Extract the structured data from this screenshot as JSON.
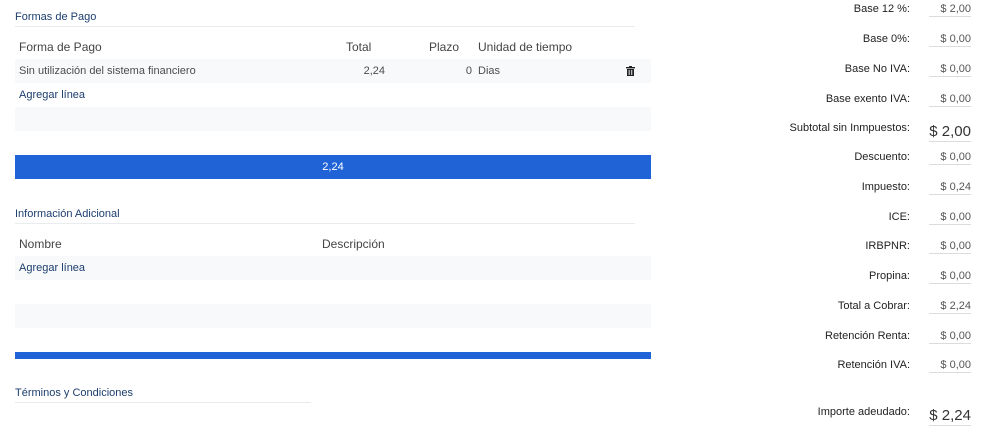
{
  "formas_pago": {
    "title": "Formas de Pago",
    "headers": [
      "Forma de Pago",
      "Total",
      "Plazo",
      "Unidad de tiempo"
    ],
    "row": {
      "forma": "Sin utilización del sistema financiero",
      "total": "2,24",
      "plazo": "0",
      "unidad": "Dias"
    },
    "add_line": "Agregar línea",
    "total_bar": "2,24"
  },
  "info_adicional": {
    "title": "Información Adicional",
    "headers": [
      "Nombre",
      "Descripción"
    ],
    "add_line": "Agregar línea"
  },
  "terminos": {
    "title": "Términos y Condiciones"
  },
  "summary": [
    {
      "label": "Base 12 %:",
      "value": "$ 2,00"
    },
    {
      "label": "Base 0%:",
      "value": "$ 0,00"
    },
    {
      "label": "Base No IVA:",
      "value": "$ 0,00"
    },
    {
      "label": "Base exento IVA:",
      "value": "$ 0,00"
    },
    {
      "label": "Subtotal sin Inmpuestos:",
      "value": "$ 2,00"
    },
    {
      "label": "Descuento:",
      "value": "$ 0,00"
    },
    {
      "label": "Impuesto:",
      "value": "$ 0,24"
    },
    {
      "label": "ICE:",
      "value": "$ 0,00"
    },
    {
      "label": "IRBPNR:",
      "value": "$ 0,00"
    },
    {
      "label": "Propina:",
      "value": "$ 0,00"
    },
    {
      "label": "Total a Cobrar:",
      "value": "$ 2,24"
    },
    {
      "label": "Retención Renta:",
      "value": "$ 0,00"
    },
    {
      "label": "Retención IVA:",
      "value": "$ 0,00"
    },
    {
      "label": "Importe adeudado:",
      "value": "$ 2,24"
    }
  ],
  "icons": {
    "delete": "trash-icon"
  }
}
